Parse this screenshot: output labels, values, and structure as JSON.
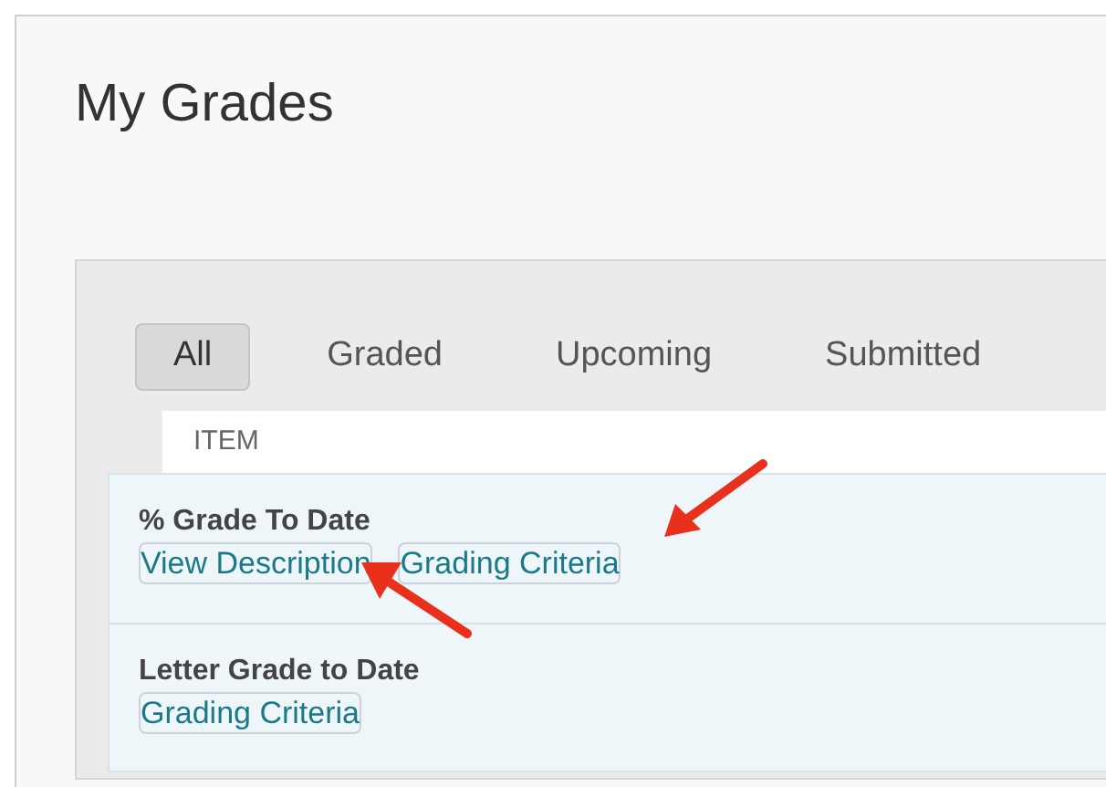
{
  "page": {
    "title": "My Grades"
  },
  "tabs": [
    {
      "label": "All",
      "selected": true
    },
    {
      "label": "Graded",
      "selected": false
    },
    {
      "label": "Upcoming",
      "selected": false
    },
    {
      "label": "Submitted",
      "selected": false
    }
  ],
  "table": {
    "columns": [
      "ITEM"
    ],
    "rows": [
      {
        "name": "% Grade To Date",
        "links": [
          "View Description",
          "Grading Criteria"
        ]
      },
      {
        "name": "Letter Grade to Date",
        "links": [
          "Grading Criteria"
        ]
      }
    ]
  }
}
